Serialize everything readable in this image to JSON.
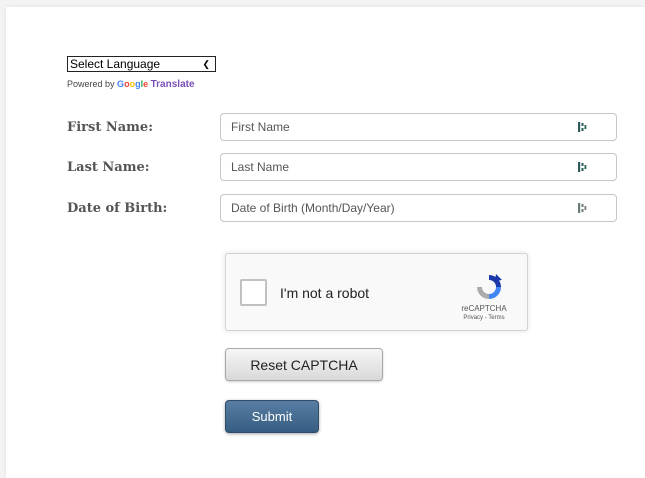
{
  "language_select": {
    "selected": "Select Language"
  },
  "powered_by": {
    "prefix": "Powered by",
    "google": "Google",
    "translate": "Translate"
  },
  "form": {
    "first_name": {
      "label": "First Name:",
      "placeholder": "First Name"
    },
    "last_name": {
      "label": "Last Name:",
      "placeholder": "Last Name"
    },
    "dob": {
      "label": "Date of Birth:",
      "placeholder": "Date of Birth (Month/Day/Year)"
    }
  },
  "recaptcha": {
    "checkbox_label": "I'm not a robot",
    "brand": "reCAPTCHA",
    "links": "Privacy - Terms"
  },
  "buttons": {
    "reset": "Reset CAPTCHA",
    "submit": "Submit"
  },
  "colors": {
    "label": "#555555",
    "submit_bg": "#3f6589",
    "google_blue": "#4285f4",
    "translate_purple": "#7b4fb8"
  }
}
